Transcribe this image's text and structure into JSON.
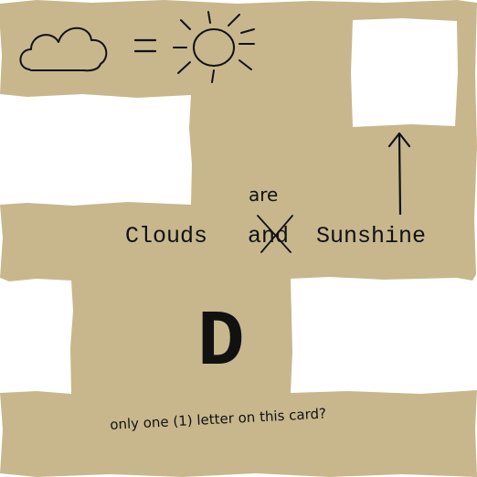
{
  "card": {
    "colors": {
      "paper": "#c8b78d",
      "ink": "#111111",
      "window": "#ffffff"
    },
    "top_left_drawing": {
      "cloud_icon": "cloud-icon",
      "equals_sign": "=",
      "sun_icon": "sun-icon"
    },
    "arrow_icon": "up-arrow-icon",
    "phrase": {
      "word1": "Clouds",
      "struck_word": "and",
      "inserted_word": "are",
      "word3": "Sunshine"
    },
    "big_letter": "D",
    "handwritten_note": "only one (1) letter on this card?"
  }
}
